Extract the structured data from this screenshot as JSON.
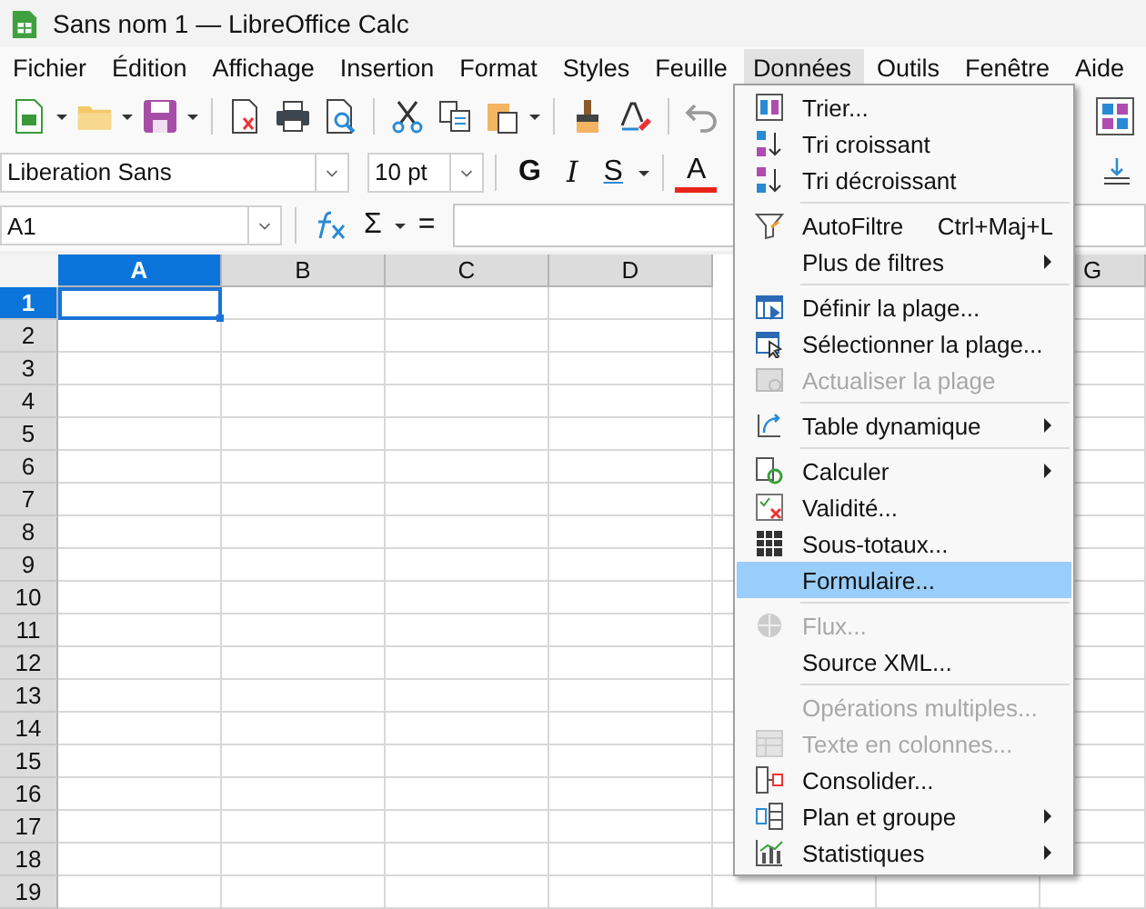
{
  "window": {
    "title": "Sans nom 1 — LibreOffice Calc"
  },
  "menu_bar": [
    {
      "label": "Fichier",
      "selected": false
    },
    {
      "label": "Édition",
      "selected": false
    },
    {
      "label": "Affichage",
      "selected": false
    },
    {
      "label": "Insertion",
      "selected": false
    },
    {
      "label": "Format",
      "selected": false
    },
    {
      "label": "Styles",
      "selected": false
    },
    {
      "label": "Feuille",
      "selected": false
    },
    {
      "label": "Données",
      "selected": true
    },
    {
      "label": "Outils",
      "selected": false
    },
    {
      "label": "Fenêtre",
      "selected": false
    },
    {
      "label": "Aide",
      "selected": false
    }
  ],
  "formatting": {
    "font_name": "Liberation Sans",
    "font_size": "10 pt",
    "bold": "G",
    "italic": "I",
    "underline": "S",
    "font_color": "A"
  },
  "formula_bar": {
    "name_box": "A1",
    "sum": "Σ",
    "equals": "="
  },
  "grid": {
    "columns": [
      {
        "label": "A",
        "selected": true
      },
      {
        "label": "B",
        "selected": false
      },
      {
        "label": "C",
        "selected": false
      },
      {
        "label": "D",
        "selected": false
      },
      {
        "label": "G",
        "selected": false
      }
    ],
    "rows": [
      {
        "label": "1",
        "selected": true
      },
      {
        "label": "2",
        "selected": false
      },
      {
        "label": "3",
        "selected": false
      },
      {
        "label": "4",
        "selected": false
      },
      {
        "label": "5",
        "selected": false
      },
      {
        "label": "6",
        "selected": false
      },
      {
        "label": "7",
        "selected": false
      },
      {
        "label": "8",
        "selected": false
      },
      {
        "label": "9",
        "selected": false
      },
      {
        "label": "10",
        "selected": false
      },
      {
        "label": "11",
        "selected": false
      },
      {
        "label": "12",
        "selected": false
      },
      {
        "label": "13",
        "selected": false
      },
      {
        "label": "14",
        "selected": false
      },
      {
        "label": "15",
        "selected": false
      },
      {
        "label": "16",
        "selected": false
      },
      {
        "label": "17",
        "selected": false
      },
      {
        "label": "18",
        "selected": false
      },
      {
        "label": "19",
        "selected": false
      }
    ]
  },
  "menu": {
    "items": [
      {
        "kind": "item",
        "label": "Trier...",
        "disabled": false,
        "submenu": false,
        "selected": false
      },
      {
        "kind": "item",
        "label": "Tri croissant",
        "disabled": false,
        "submenu": false,
        "selected": false
      },
      {
        "kind": "item",
        "label": "Tri décroissant",
        "disabled": false,
        "submenu": false,
        "selected": false
      },
      {
        "kind": "separator"
      },
      {
        "kind": "item",
        "label": "AutoFiltre",
        "shortcut": "Ctrl+Maj+L",
        "disabled": false,
        "submenu": false,
        "selected": false
      },
      {
        "kind": "item",
        "label": "Plus de filtres",
        "disabled": false,
        "submenu": true,
        "selected": false
      },
      {
        "kind": "separator"
      },
      {
        "kind": "item",
        "label": "Définir la plage...",
        "disabled": false,
        "submenu": false,
        "selected": false
      },
      {
        "kind": "item",
        "label": "Sélectionner la plage...",
        "disabled": false,
        "submenu": false,
        "selected": false
      },
      {
        "kind": "item",
        "label": "Actualiser la plage",
        "disabled": true,
        "submenu": false,
        "selected": false
      },
      {
        "kind": "separator"
      },
      {
        "kind": "item",
        "label": "Table dynamique",
        "disabled": false,
        "submenu": true,
        "selected": false
      },
      {
        "kind": "separator"
      },
      {
        "kind": "item",
        "label": "Calculer",
        "disabled": false,
        "submenu": true,
        "selected": false
      },
      {
        "kind": "item",
        "label": "Validité...",
        "disabled": false,
        "submenu": false,
        "selected": false
      },
      {
        "kind": "item",
        "label": "Sous-totaux...",
        "disabled": false,
        "submenu": false,
        "selected": false
      },
      {
        "kind": "item",
        "label": "Formulaire...",
        "disabled": false,
        "submenu": false,
        "selected": true
      },
      {
        "kind": "separator"
      },
      {
        "kind": "item",
        "label": "Flux...",
        "disabled": true,
        "submenu": false,
        "selected": false
      },
      {
        "kind": "item",
        "label": "Source XML...",
        "disabled": false,
        "submenu": false,
        "selected": false
      },
      {
        "kind": "separator"
      },
      {
        "kind": "item",
        "label": "Opérations multiples...",
        "disabled": true,
        "submenu": false,
        "selected": false
      },
      {
        "kind": "item",
        "label": "Texte en colonnes...",
        "disabled": true,
        "submenu": false,
        "selected": false
      },
      {
        "kind": "item",
        "label": "Consolider...",
        "disabled": false,
        "submenu": false,
        "selected": false
      },
      {
        "kind": "item",
        "label": "Plan et groupe",
        "disabled": false,
        "submenu": true,
        "selected": false
      },
      {
        "kind": "item",
        "label": "Statistiques",
        "disabled": false,
        "submenu": true,
        "selected": false
      }
    ]
  }
}
